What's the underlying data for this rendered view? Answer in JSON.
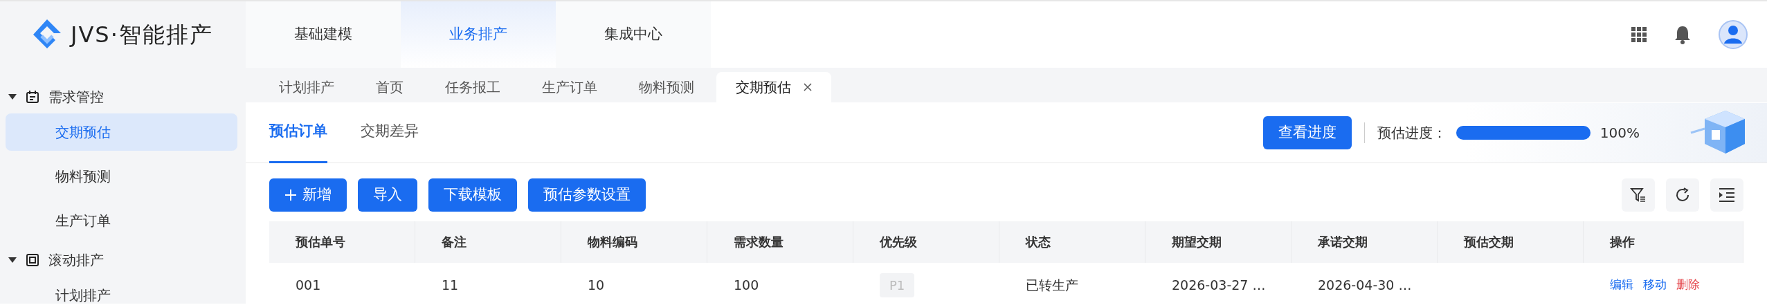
{
  "app": {
    "title": "JVS·智能排产"
  },
  "top_nav": [
    {
      "label": "基础建模",
      "selected": false
    },
    {
      "label": "业务排产",
      "selected": true
    },
    {
      "label": "集成中心",
      "selected": false
    }
  ],
  "sidebar": [
    {
      "label": "需求管控",
      "kind": "calendar",
      "expanded": true,
      "children": [
        {
          "label": "交期预估",
          "selected": true
        },
        {
          "label": "物料预测",
          "selected": false
        },
        {
          "label": "生产订单",
          "selected": false
        }
      ]
    },
    {
      "label": "滚动排产",
      "kind": "frame",
      "expanded": true,
      "children": [
        {
          "label": "计划排产",
          "selected": false
        }
      ]
    }
  ],
  "page_tabs": [
    {
      "label": "计划排产",
      "selected": false,
      "closable": false
    },
    {
      "label": "首页",
      "selected": false,
      "closable": false
    },
    {
      "label": "任务报工",
      "selected": false,
      "closable": false
    },
    {
      "label": "生产订单",
      "selected": false,
      "closable": false
    },
    {
      "label": "物料预测",
      "selected": false,
      "closable": false
    },
    {
      "label": "交期预估",
      "selected": true,
      "closable": true
    }
  ],
  "sub_tabs": [
    {
      "label": "预估订单",
      "selected": true
    },
    {
      "label": "交期差异",
      "selected": false
    }
  ],
  "progress": {
    "button": "查看进度",
    "label": "预估进度：",
    "level": 1,
    "reading": "100%"
  },
  "toolbar": [
    {
      "label": "新增",
      "kind": "add"
    },
    {
      "label": "导入",
      "kind": "plain"
    },
    {
      "label": "下载模板",
      "kind": "plain"
    },
    {
      "label": "预估参数设置",
      "kind": "plain"
    }
  ],
  "table": {
    "columns": [
      "预估单号",
      "备注",
      "物料编码",
      "需求数量",
      "优先级",
      "状态",
      "期望交期",
      "承诺交期",
      "预估交期",
      "操作"
    ],
    "rows": [
      {
        "order_no": "001",
        "note": "11",
        "material_code": "10",
        "quantity": "100",
        "priority": "P1",
        "status": "已转生产",
        "expected_date": "2026-03-27 …",
        "promised_date": "2026-04-30 …",
        "actions": [
          {
            "label": "编辑",
            "kind": "normal"
          },
          {
            "label": "移动",
            "kind": "normal"
          },
          {
            "label": "删除",
            "kind": "danger"
          }
        ]
      }
    ]
  }
}
